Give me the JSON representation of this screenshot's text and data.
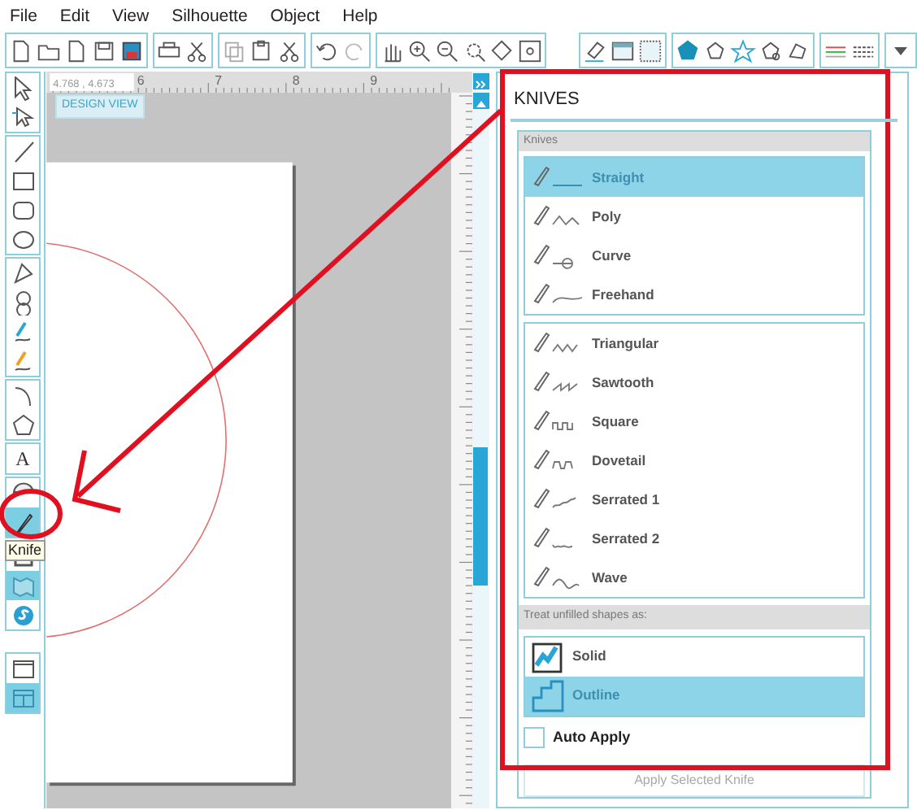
{
  "menu": [
    "File",
    "Edit",
    "View",
    "Silhouette",
    "Object",
    "Help"
  ],
  "tools": [
    [
      {
        "selected": false
      },
      {
        "selected": false
      }
    ],
    [
      {
        "selected": false
      },
      {
        "selected": false
      },
      {
        "selected": false
      },
      {
        "selected": false
      }
    ],
    [
      {
        "selected": false
      },
      {
        "selected": false
      },
      {
        "selected": false
      },
      {
        "selected": false
      }
    ],
    [
      {
        "selected": false
      },
      {
        "selected": false
      }
    ],
    [
      {
        "selected": false,
        "label": "A"
      }
    ],
    [
      {
        "selected": false
      },
      {
        "selected": true
      }
    ],
    [
      {
        "selected": false
      },
      {
        "selected": true
      },
      {
        "selected": false
      }
    ],
    [
      {
        "selected": false
      },
      {
        "selected": true
      }
    ]
  ],
  "tooltip": "Knife",
  "ruler": {
    "coordinates": "4.768 , 4.673",
    "labels": [
      "6",
      "7",
      "8",
      "9"
    ]
  },
  "view_badge": "DESIGN VIEW",
  "panel": {
    "title": "KNIVES",
    "group_label": "Knives",
    "knife_lists": [
      [
        {
          "label": "Straight",
          "selected": true
        },
        {
          "label": "Poly",
          "selected": false
        },
        {
          "label": "Curve",
          "selected": false
        },
        {
          "label": "Freehand",
          "selected": false
        }
      ],
      [
        {
          "label": "Triangular",
          "selected": false
        },
        {
          "label": "Sawtooth",
          "selected": false
        },
        {
          "label": "Square",
          "selected": false
        },
        {
          "label": "Dovetail",
          "selected": false
        },
        {
          "label": "Serrated 1",
          "selected": false
        },
        {
          "label": "Serrated 2",
          "selected": false
        },
        {
          "label": "Wave",
          "selected": false
        }
      ]
    ],
    "treat_label": "Treat unfilled shapes as:",
    "modes": [
      {
        "label": "Solid",
        "selected": false
      },
      {
        "label": "Outline",
        "selected": true
      }
    ],
    "auto_apply": {
      "label": "Auto Apply",
      "checked": false
    },
    "apply_button": {
      "label": "Apply Selected Knife",
      "disabled": true
    }
  }
}
